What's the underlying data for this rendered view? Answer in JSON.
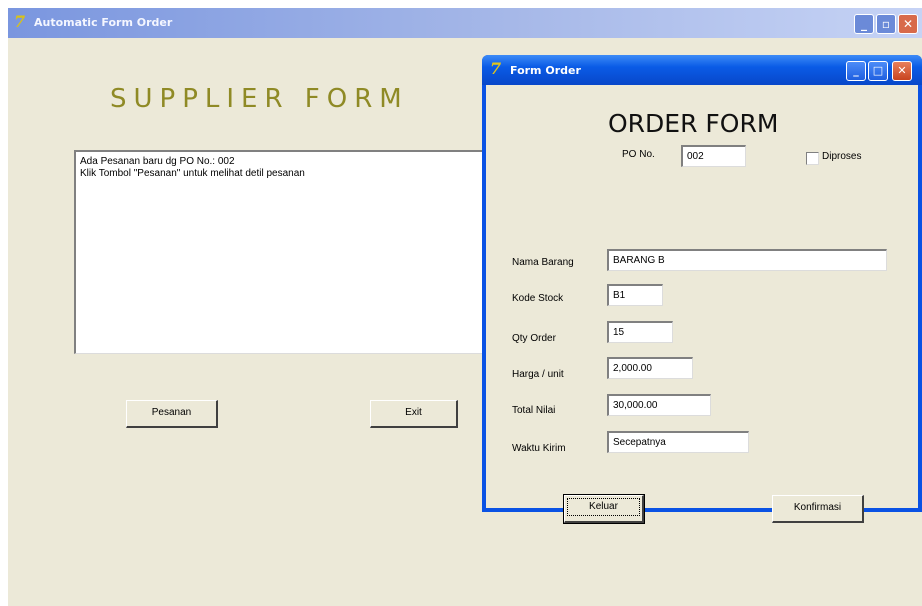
{
  "main_window": {
    "title": "Automatic Form Order",
    "heading": "SUPPLIER FORM",
    "memo_lines": [
      "Ada Pesanan baru dg PO No.: 002",
      "Klik Tombol \"Pesanan\" untuk melihat detil pesanan"
    ],
    "buttons": {
      "pesanan": "Pesanan",
      "exit": "Exit"
    },
    "controls": {
      "minimize": "_",
      "maximize": "▫",
      "close": "✕"
    }
  },
  "dialog": {
    "title": "Form Order",
    "heading": "ORDER FORM",
    "po_label": "PO No.",
    "po_value": "002",
    "diproses_label": "Diproses",
    "diproses_checked": false,
    "fields": {
      "nama_barang": {
        "label": "Nama Barang",
        "value": "BARANG B"
      },
      "kode_stock": {
        "label": "Kode Stock",
        "value": "B1"
      },
      "qty_order": {
        "label": "Qty Order",
        "value": "15"
      },
      "harga_unit": {
        "label": "Harga / unit",
        "value": "2,000.00"
      },
      "total_nilai": {
        "label": "Total Nilai",
        "value": "30,000.00"
      },
      "waktu_kirim": {
        "label": "Waktu Kirim",
        "value": "Secepatnya"
      }
    },
    "buttons": {
      "keluar": "Keluar",
      "konfirmasi": "Konfirmasi"
    },
    "controls": {
      "minimize": "_",
      "maximize": "□",
      "close": "✕"
    }
  },
  "colors": {
    "window_bg": "#ece9d8",
    "supplier_heading": "#8f8a25",
    "dialog_frame": "#0a52e4",
    "app_icon": "#d8c21a"
  },
  "icons": {
    "app": "delphi-icon"
  }
}
